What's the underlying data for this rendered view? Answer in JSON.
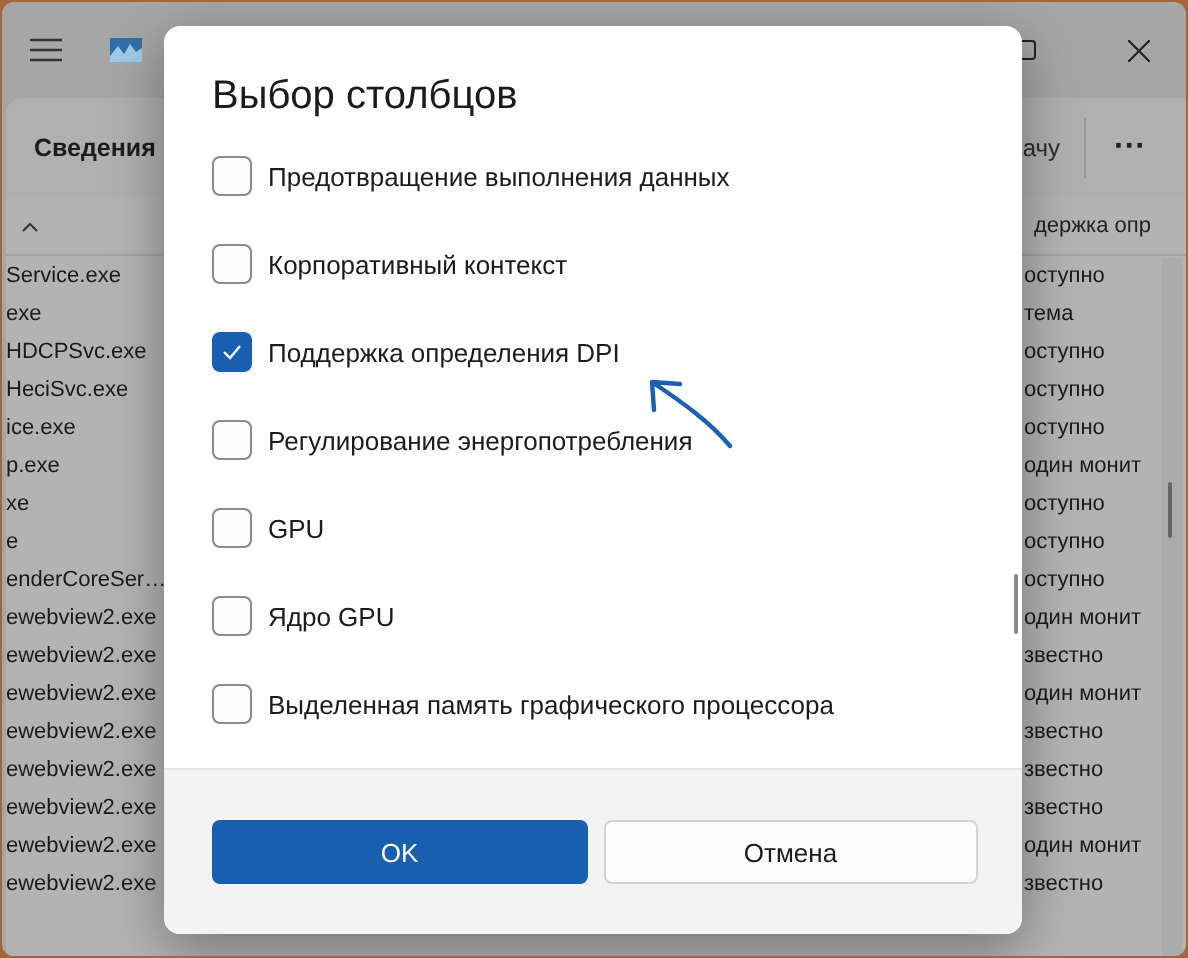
{
  "app": {
    "toolbar": {
      "title": "Сведения",
      "action": "ачу",
      "more": "···"
    },
    "list": {
      "header": "держка опр",
      "rows": [
        {
          "name": "Service.exe",
          "value": "оступно"
        },
        {
          "name": "exe",
          "value": "тема"
        },
        {
          "name": "HDCPSvc.exe",
          "value": "оступно"
        },
        {
          "name": "HeciSvc.exe",
          "value": "оступно"
        },
        {
          "name": "ice.exe",
          "value": "оступно"
        },
        {
          "name": "p.exe",
          "value": "один монит"
        },
        {
          "name": "xe",
          "value": "оступно"
        },
        {
          "name": "e",
          "value": "оступно"
        },
        {
          "name": "enderCoreSer…",
          "value": "оступно"
        },
        {
          "name": "ewebview2.exe",
          "value": "один монит"
        },
        {
          "name": "ewebview2.exe",
          "value": "звестно"
        },
        {
          "name": "ewebview2.exe",
          "value": "один монит"
        },
        {
          "name": "ewebview2.exe",
          "value": "звестно"
        },
        {
          "name": "ewebview2.exe",
          "value": "звестно"
        },
        {
          "name": "ewebview2.exe",
          "value": "звестно"
        },
        {
          "name": "ewebview2.exe",
          "value": "один монит"
        },
        {
          "name": "ewebview2.exe",
          "value": "звестно"
        }
      ]
    }
  },
  "dialog": {
    "title": "Выбор столбцов",
    "options": [
      {
        "label": "Предотвращение выполнения данных",
        "checked": false
      },
      {
        "label": "Корпоративный контекст",
        "checked": false
      },
      {
        "label": "Поддержка определения DPI",
        "checked": true
      },
      {
        "label": "Регулирование энергопотребления",
        "checked": false
      },
      {
        "label": "GPU",
        "checked": false
      },
      {
        "label": "Ядро GPU",
        "checked": false
      },
      {
        "label": "Выделенная память графического процессора",
        "checked": false
      }
    ],
    "buttons": [
      {
        "label": "OK",
        "kind": "primary"
      },
      {
        "label": "Отмена",
        "kind": "secondary"
      }
    ]
  }
}
